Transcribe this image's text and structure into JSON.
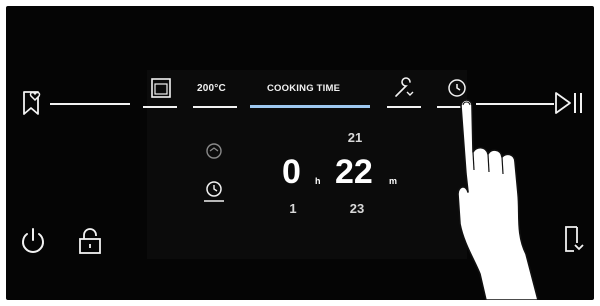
{
  "display": {
    "tabs": {
      "temperature": "200°C",
      "cooking_time": "COOKING TIME"
    },
    "time": {
      "hours_value": "0",
      "hours_unit": "h",
      "minutes_value": "22",
      "minutes_unit": "m",
      "hours_next": "1",
      "minutes_prev": "21",
      "minutes_next": "23"
    }
  },
  "icons": {
    "favourite": "bookmark-heart-icon",
    "play_pause": "play-pause-icon",
    "power": "power-icon",
    "lock": "lock-icon",
    "door": "door-icon",
    "oven": "oven-icon",
    "probe": "meat-probe-icon",
    "timer": "timer-icon",
    "duration": "duration-icon",
    "end_time": "end-time-icon",
    "hand": "hand-pointer-icon"
  }
}
